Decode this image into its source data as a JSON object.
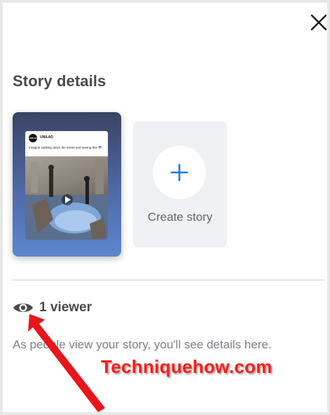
{
  "header": {
    "close_icon": "close-icon"
  },
  "title": "Story details",
  "story": {
    "account_name": "UNILAD",
    "logo_text": "UNILAD",
    "caption": "Imagine walking down the street and seeing this 😳"
  },
  "create_story": {
    "label": "Create story",
    "icon": "plus-icon",
    "accent": "#1877f2"
  },
  "viewers": {
    "icon": "eye-icon",
    "label": "1 viewer"
  },
  "description": "As people view your story, you'll see details here.",
  "watermark": "Techniquehow.com",
  "colors": {
    "arrow": "#e8151b",
    "watermark": "#ff1a1a"
  }
}
